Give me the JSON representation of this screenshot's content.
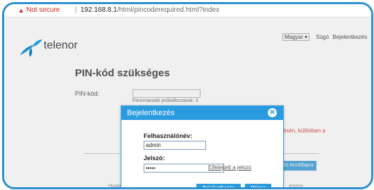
{
  "browser": {
    "warning_icon": "▲",
    "security_text": "Not secure",
    "separator": "|",
    "url_host": "192.168.8.1",
    "url_path": "/html/pincoderequired.html?index"
  },
  "header": {
    "language": "Magyar ▾",
    "help": "Súgó",
    "login": "Bejelentkezés",
    "logo_text": "telenor"
  },
  "main": {
    "title": "PIN-kód szükséges",
    "pin_label": "PIN-kód:",
    "attempts_text": "Fennmaradó próbálkozások:  3",
    "red_text": "zésén, különben a",
    "login_page_button": "és kezdőlapra",
    "footer_left": "Huawe",
    "footer_right": "emeny"
  },
  "modal": {
    "title": "Bejelentkezés",
    "close_glyph": "✕",
    "username_label": "Felhasználónév:",
    "username_value": "admin",
    "password_label": "Jelszó:",
    "password_value": "•••••",
    "forgot_link": "Elfelejtett a jelszó",
    "login_button": "Bejelentkezés",
    "cancel_button": "Mégse"
  },
  "colors": {
    "accent": "#2b9be0",
    "frame": "#2e8fcf",
    "warning": "#c5221f"
  }
}
